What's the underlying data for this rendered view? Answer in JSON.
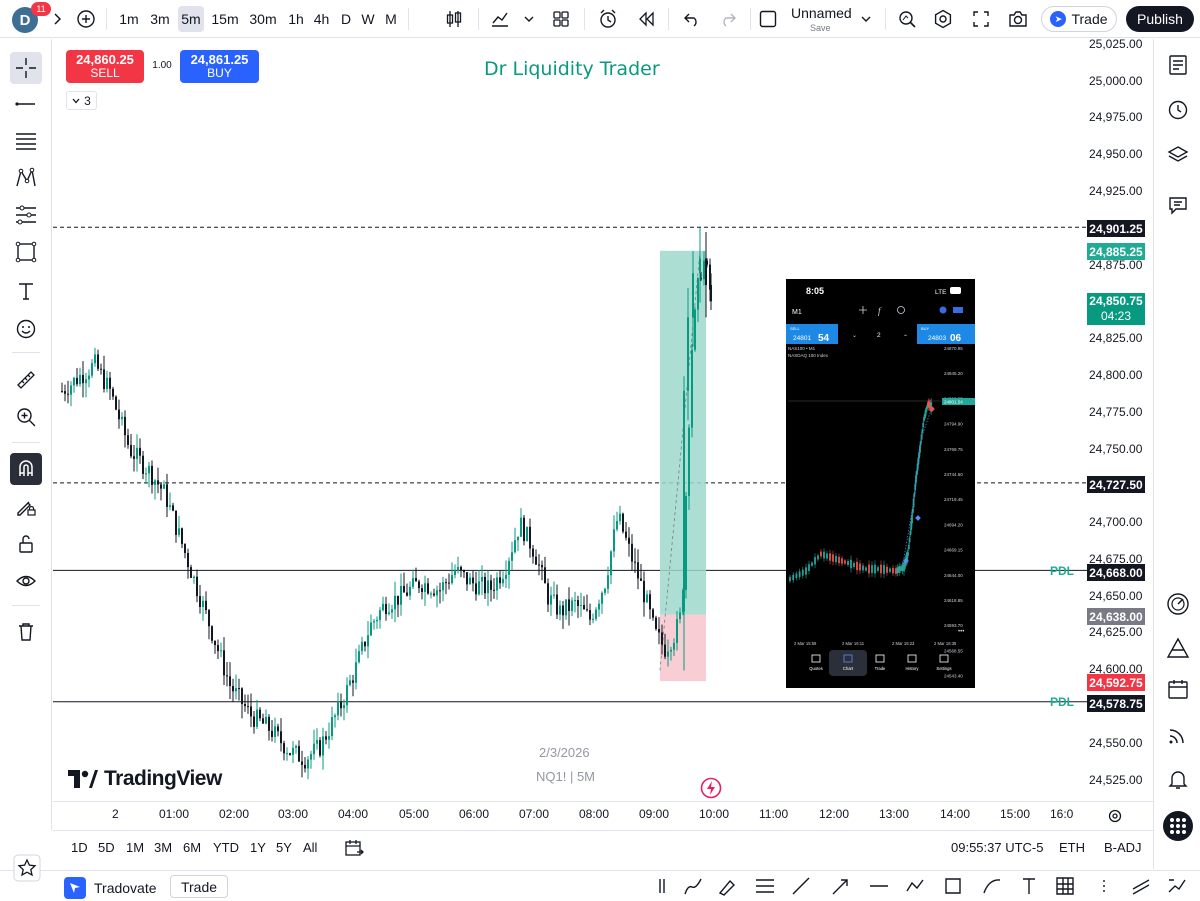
{
  "toolbar": {
    "avatar_letter": "D",
    "notification_count": "11",
    "intervals": [
      "1m",
      "3m",
      "5m",
      "15m",
      "30m",
      "1h",
      "4h",
      "D",
      "W",
      "M"
    ],
    "active_interval": "5m",
    "layout_name": "Unnamed",
    "layout_status": "Save",
    "trade_label": "Trade",
    "publish_label": "Publish"
  },
  "order_panel": {
    "sell_price": "24,860.25",
    "sell_label": "SELL",
    "quantity": "1.00",
    "buy_price": "24,861.25",
    "buy_label": "BUY",
    "collapsed_count": "3"
  },
  "chart": {
    "title": "Dr Liquidity Trader",
    "watermark_date": "2/3/2026",
    "watermark_symbol": "NQ1! | 5M",
    "logo_text": "TradingView",
    "pdl_label": "PDL",
    "colors": {
      "up": "#089981",
      "down": "#131722",
      "title": "#089981",
      "pdl": "#22ab94",
      "profit_zone": "#9fd8cc",
      "loss_zone": "#f7c9cf"
    }
  },
  "price_axis": {
    "ticks": [
      "25,025.00",
      "25,000.00",
      "24,975.00",
      "24,950.00",
      "24,925.00",
      "24,875.00",
      "24,825.00",
      "24,800.00",
      "24,775.00",
      "24,750.00",
      "24,700.00",
      "24,675.00",
      "24,650.00",
      "24,625.00",
      "24,600.00",
      "24,550.00",
      "24,525.00"
    ],
    "tags": {
      "line_high": "24,901.25",
      "target": "24,885.25",
      "last_price": "24,850.75",
      "countdown": "04:23",
      "line_mid": "24,727.50",
      "pdl_upper": "24,668.00",
      "entry": "24,638.00",
      "stop": "24,592.75",
      "pdl_lower": "24,578.75"
    }
  },
  "time_axis": {
    "ticks": [
      "2",
      "01:00",
      "02:00",
      "03:00",
      "04:00",
      "05:00",
      "06:00",
      "07:00",
      "08:00",
      "09:00",
      "10:00",
      "11:00",
      "12:00",
      "13:00",
      "14:00",
      "15:00",
      "16:0"
    ]
  },
  "phone_screenshot": {
    "clock": "8:05",
    "network": "LTE",
    "timeframe": "M1",
    "sell_label": "SELL",
    "sell_price_small": "24801",
    "sell_price_big": "54",
    "lots": "2",
    "buy_label": "BUY",
    "buy_price_small": "24803",
    "buy_price_big": "06",
    "symbol_line": "NAS100 • M1",
    "symbol_name": "NASDAQ 100 Index",
    "price_labels": [
      "24870.95",
      "24845.20",
      "24820.05",
      "24794.90",
      "24769.75",
      "24744.60",
      "24719.45",
      "24694.20",
      "24669.15",
      "24644.00",
      "24618.85",
      "24593.70",
      "24568.55",
      "24543.40",
      "24518.25"
    ],
    "current_tag": "24801.54",
    "dates": [
      "2 Mar 15:59",
      "2 Mar 16:11",
      "2 Mar 16:23",
      "2 Mar 16:35"
    ],
    "nav": [
      "Quotes",
      "Chart",
      "Trade",
      "History",
      "Settings"
    ]
  },
  "range_bar": {
    "ranges": [
      "1D",
      "5D",
      "1M",
      "3M",
      "6M",
      "YTD",
      "1Y",
      "5Y",
      "All"
    ],
    "clock": "09:55:37 UTC-5",
    "session": "ETH",
    "adjustment": "B-ADJ"
  },
  "bottom_panel": {
    "broker": "Tradovate",
    "trade_tab": "Trade"
  }
}
